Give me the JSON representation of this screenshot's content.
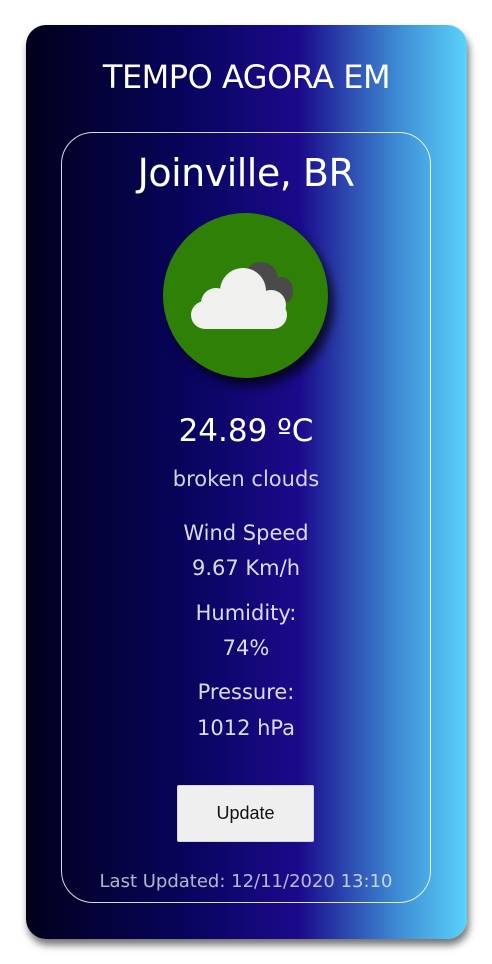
{
  "header": {
    "title": "TEMPO AGORA EM"
  },
  "weather": {
    "city": "Joinville, BR",
    "icon": "broken-clouds-icon",
    "temperature": "24.89 ºC",
    "description": "broken clouds",
    "wind_label": "Wind Speed",
    "wind_value": "9.67 Km/h",
    "humidity_label": "Humidity:",
    "humidity_value": "74%",
    "pressure_label": "Pressure:",
    "pressure_value": "1012 hPa",
    "update_label": "Update",
    "last_updated": "Last Updated: 12/11/2020 13:10"
  },
  "colors": {
    "icon_background": "#2e8006",
    "gradient_start": "#02001c",
    "gradient_mid": "#1b0a8c",
    "gradient_end": "#5bd2fb"
  }
}
